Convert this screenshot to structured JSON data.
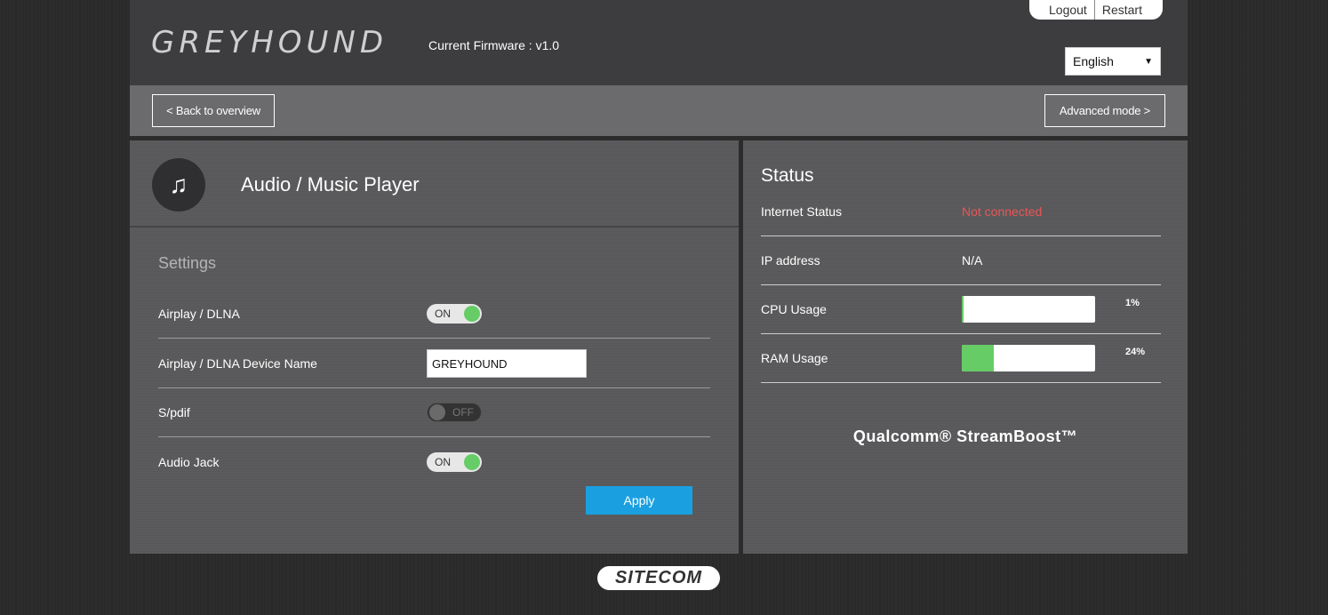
{
  "header": {
    "logo": "GREYHOUND",
    "firmware": "Current Firmware : v1.0",
    "logout": "Logout",
    "restart": "Restart",
    "language": "English"
  },
  "toolbar": {
    "back": "< Back to overview",
    "advanced": "Advanced mode >"
  },
  "left_panel": {
    "icon": "music-note-icon",
    "title": "Audio / Music Player",
    "settings_title": "Settings",
    "rows": [
      {
        "label": "Airplay / DLNA",
        "toggle": "ON"
      },
      {
        "label": "Airplay / DLNA Device Name",
        "value": "GREYHOUND"
      },
      {
        "label": "S/pdif",
        "toggle": "OFF"
      },
      {
        "label": "Audio Jack",
        "toggle": "ON"
      }
    ],
    "apply": "Apply"
  },
  "status": {
    "title": "Status",
    "internet_label": "Internet Status",
    "internet_value": "Not connected",
    "ip_label": "IP address",
    "ip_value": "N/A",
    "cpu_label": "CPU Usage",
    "cpu_value": "1%",
    "cpu_fraction": 0.01,
    "ram_label": "RAM Usage",
    "ram_value": "24%",
    "ram_fraction": 0.24,
    "brand": "Qualcomm® StreamBoost™"
  },
  "footer": {
    "logo": "SITECOM"
  },
  "colors": {
    "accent": "#1aa0e0",
    "toggle_on": "#66cc66",
    "error": "#e85555"
  }
}
